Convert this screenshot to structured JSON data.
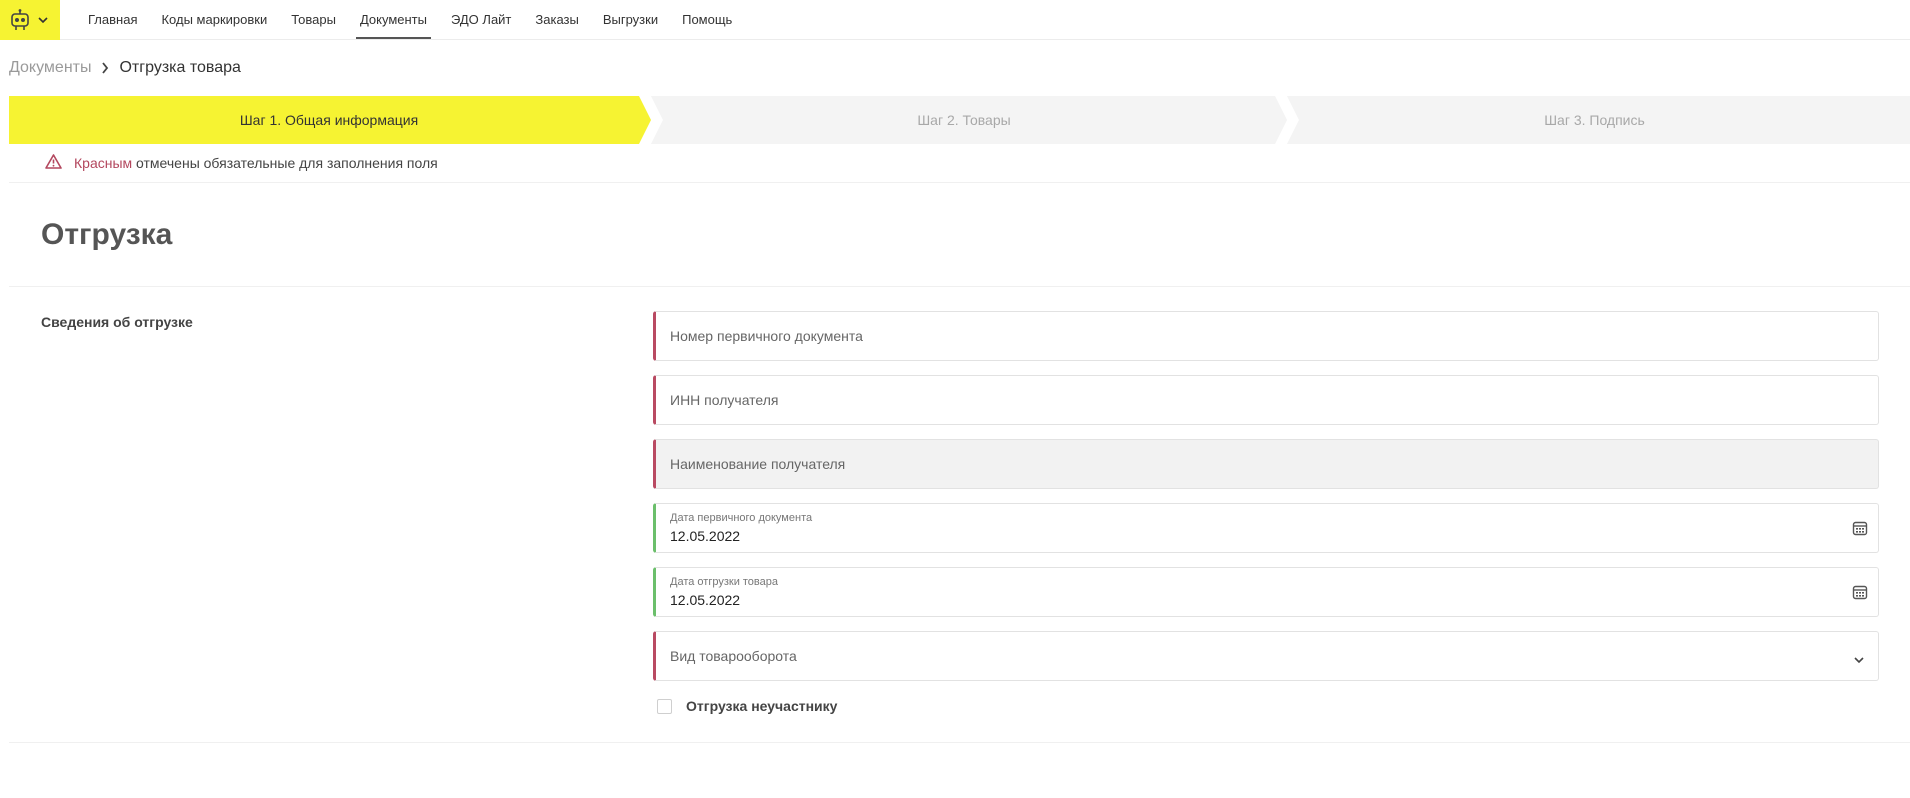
{
  "nav": {
    "items": [
      {
        "label": "Главная"
      },
      {
        "label": "Коды маркировки"
      },
      {
        "label": "Товары"
      },
      {
        "label": "Документы",
        "active": true
      },
      {
        "label": "ЭДО Лайт"
      },
      {
        "label": "Заказы"
      },
      {
        "label": "Выгрузки"
      },
      {
        "label": "Помощь"
      }
    ],
    "logo_icon": "robot-logo-icon",
    "accent_color": "#f6f332"
  },
  "breadcrumb": {
    "parent": "Документы",
    "current": "Отгрузка товара"
  },
  "steps": [
    {
      "label": "Шаг 1. Общая информация",
      "active": true
    },
    {
      "label": "Шаг 2. Товары",
      "active": false
    },
    {
      "label": "Шаг 3. Подпись",
      "active": false
    }
  ],
  "notice": {
    "highlight": "Красным",
    "text": " отмечены обязательные для заполнения поля",
    "icon": "warning-triangle-icon",
    "highlight_color": "#b3475e"
  },
  "page": {
    "title": "Отгрузка",
    "section_label": "Сведения об отгрузке"
  },
  "form": {
    "doc_number": {
      "placeholder": "Номер первичного документа"
    },
    "inn": {
      "placeholder": "ИНН получателя"
    },
    "recipient_name": {
      "placeholder": "Наименование получателя"
    },
    "doc_date": {
      "label": "Дата первичного документа",
      "value": "12.05.2022"
    },
    "ship_date": {
      "label": "Дата отгрузки товара",
      "value": "12.05.2022"
    },
    "turnover_type": {
      "placeholder": "Вид товарооборота"
    },
    "non_participant": {
      "label": "Отгрузка неучастнику",
      "checked": false
    }
  },
  "colors": {
    "required": "#b94a62",
    "valid": "#6bbf6b"
  }
}
